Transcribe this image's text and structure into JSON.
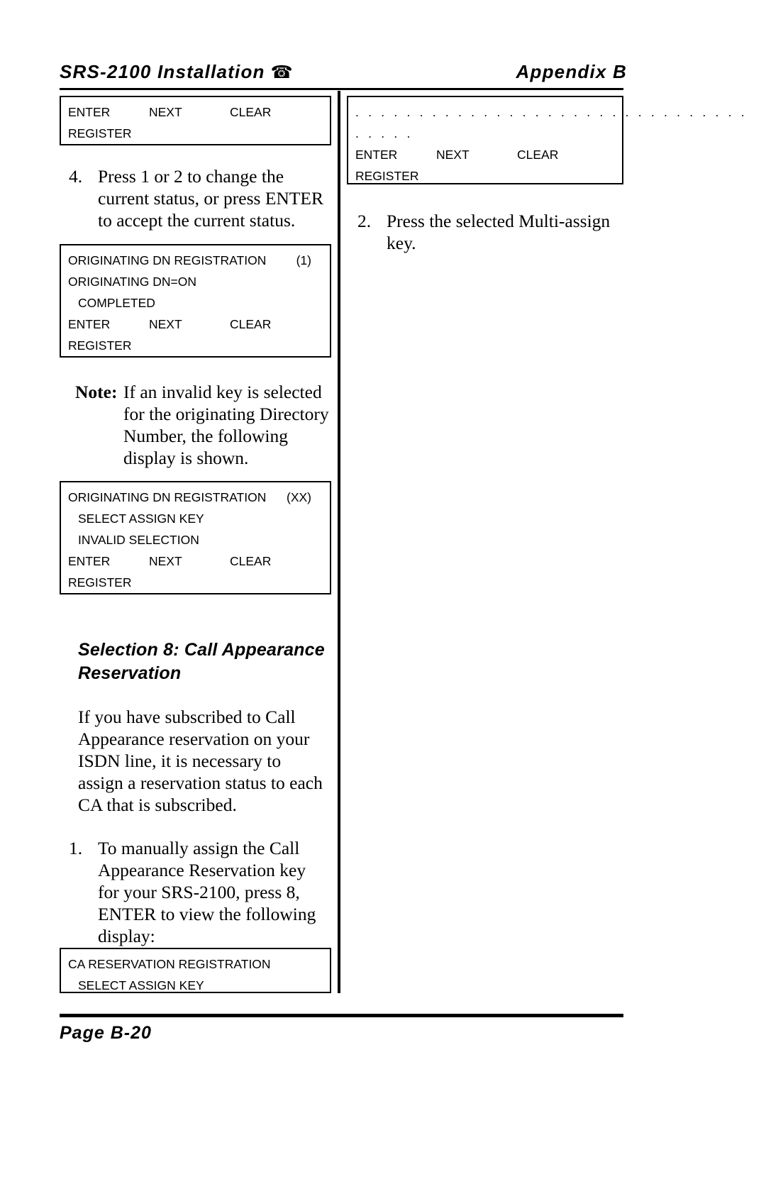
{
  "header": {
    "left_title": "SRS-2100 Installation",
    "phone_icon": "☎",
    "right_title": "Appendix B"
  },
  "footer": {
    "page_label": "Page B-20"
  },
  "keys": {
    "enter": "ENTER",
    "next": "NEXT",
    "clear": "CLEAR",
    "register": "REGISTER"
  },
  "left_column": {
    "display_1": {
      "line_keys": "",
      "line_register": "REGISTER"
    },
    "step_4": {
      "marker": "4.",
      "text": "Press 1 or 2 to change the current status, or press ENTER to accept the current status."
    },
    "display_2": {
      "title": "ORIGINATING DN REGISTRATION",
      "index": "(1)",
      "line2": "ORIGINATING DN=ON",
      "line3": "COMPLETED"
    },
    "note": {
      "marker": "Note:",
      "text": "If an invalid key is selected for the originating Directory Number, the following display is shown."
    },
    "display_3": {
      "title": "ORIGINATING DN REGISTRATION",
      "index": "(XX)",
      "line2": "SELECT ASSIGN KEY",
      "line3": "INVALID SELECTION"
    },
    "section_heading": "Selection 8: Call Appearance Reservation",
    "body_paragraph": "If you have subscribed to Call Appearance reservation on your ISDN line, it is necessary to assign a reservation status to each CA that is subscribed.",
    "step_1": {
      "marker": "1.",
      "text": "To manually assign the Call Appearance Reservation key for your SRS-2100, press 8, ENTER to view the following display:"
    },
    "display_4": {
      "title": "CA RESERVATION REGISTRATION",
      "line2": "SELECT ASSIGN KEY"
    }
  },
  "right_column": {
    "display_1": {
      "dots_line_1": ". . . . . . . . . . . . . . . . . . . . . . . . . . . . . . .",
      "dots_line_2": ". . . . ."
    },
    "step_2": {
      "marker": "2.",
      "text": "Press the selected Multi-assign key."
    }
  }
}
